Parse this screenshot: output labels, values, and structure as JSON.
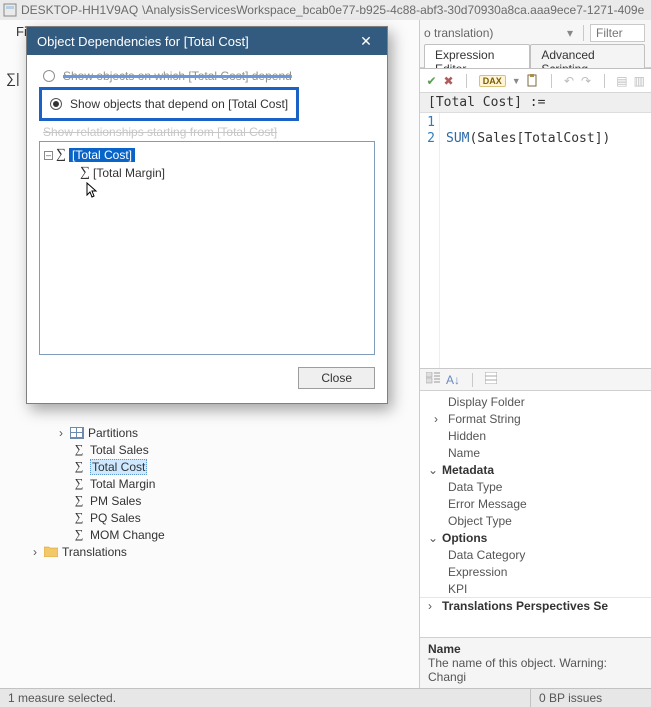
{
  "window": {
    "title_host": "DESKTOP-HH1V9AQ",
    "title_path": "\\AnalysisServicesWorkspace_bcab0e77-b925-4c88-abf3-30d70930a8ca.aaa9ece7-1271-409e"
  },
  "left": {
    "menu_fragment": "Fi",
    "tree": {
      "partitions_label": "Partitions",
      "measures": [
        "Total Sales",
        "Total Cost",
        "Total Margin",
        "PM Sales",
        "PQ Sales",
        "MOM Change"
      ],
      "selected_index": 1,
      "translations_label": "Translations"
    }
  },
  "right": {
    "toolbar_fragment": "o translation)",
    "filter_placeholder": "Filter",
    "tabs": {
      "editor": "Expression Editor",
      "scripting": "Advanced Scripting"
    },
    "editor": {
      "header": "[Total Cost] :=",
      "lines": [
        "1",
        "2"
      ],
      "code_line2_fn": "SUM",
      "code_line2_arg": "(Sales[TotalCost])"
    },
    "properties": {
      "rows": [
        {
          "label": "Display Folder",
          "indent": true
        },
        {
          "label": "Format String",
          "indent": true,
          "expand": ">"
        },
        {
          "label": "Hidden",
          "indent": true
        },
        {
          "label": "Name",
          "indent": true
        },
        {
          "label": "Metadata",
          "cat": true,
          "expand": "v"
        },
        {
          "label": "Data Type",
          "indent": true
        },
        {
          "label": "Error Message",
          "indent": true
        },
        {
          "label": "Object Type",
          "indent": true
        },
        {
          "label": "Options",
          "cat": true,
          "expand": "v"
        },
        {
          "label": "Data Category",
          "indent": true
        },
        {
          "label": "Expression",
          "indent": true
        },
        {
          "label": "KPI",
          "indent": true
        },
        {
          "label": "Translations  Perspectives  Se",
          "cat": true,
          "expand": ">"
        }
      ],
      "desc_name": "Name",
      "desc_text": "The name of this object. Warning: Changi"
    }
  },
  "dialog": {
    "title": "Object Dependencies for [Total Cost]",
    "radio1_fragment": "Show objects on which [Total Cost] depend",
    "radio2": "Show objects that depend on [Total Cost]",
    "radio3_fragment": "Show relationships starting from [Total Cost]",
    "tree": {
      "root": "[Total Cost]",
      "child": "[Total Margin]"
    },
    "close_btn": "Close"
  },
  "status": {
    "left": "1 measure selected.",
    "right": "0 BP issues"
  }
}
